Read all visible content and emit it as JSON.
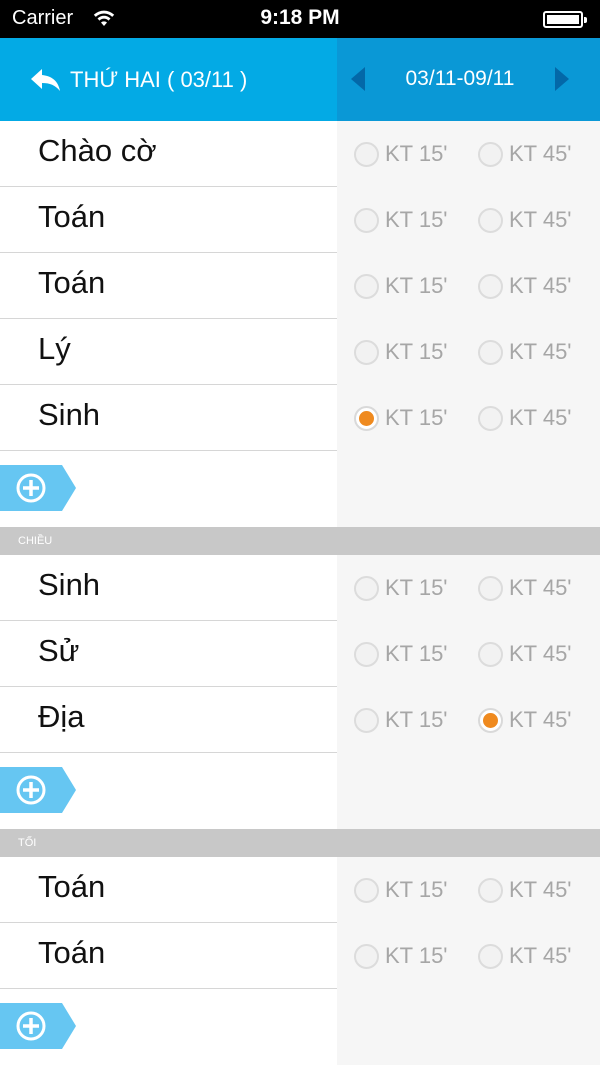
{
  "status_bar": {
    "carrier": "Carrier",
    "time": "9:18 PM"
  },
  "nav": {
    "back_label": "THỨ HAI ( 03/11 )",
    "week_range": "03/11-09/11"
  },
  "colors": {
    "accent": "#03aae5",
    "accent_dark": "#0a98d6",
    "selected": "#ef8a1f",
    "section_band": "#c8c8c8"
  },
  "options": {
    "short_test": "KT 15'",
    "long_test": "KT 45'"
  },
  "sections": [
    {
      "header": "",
      "subjects": [
        {
          "name": "Chào cờ",
          "selected": ""
        },
        {
          "name": "Toán",
          "selected": ""
        },
        {
          "name": "Toán",
          "selected": ""
        },
        {
          "name": "Lý",
          "selected": ""
        },
        {
          "name": "Sinh",
          "selected": "KT 15'"
        }
      ]
    },
    {
      "header": "CHIỀU",
      "subjects": [
        {
          "name": "Sinh",
          "selected": ""
        },
        {
          "name": "Sử",
          "selected": ""
        },
        {
          "name": "Địa",
          "selected": "KT 45'"
        }
      ]
    },
    {
      "header": "TỐI",
      "subjects": [
        {
          "name": "Toán",
          "selected": ""
        },
        {
          "name": "Toán",
          "selected": ""
        }
      ]
    }
  ]
}
